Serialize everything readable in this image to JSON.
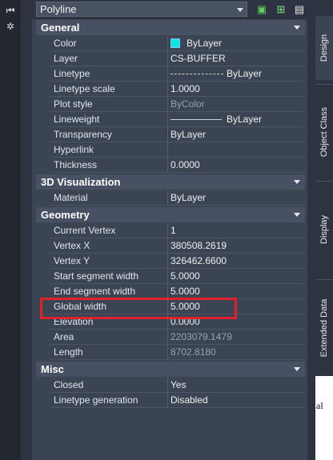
{
  "palette": {
    "object_type": "Polyline",
    "toolbar": {
      "quick_select_icon": "quick-select-icon",
      "select_objects_icon": "select-objects-icon",
      "toggle_pickadd_icon": "toggle-pickadd-icon"
    },
    "left_icons": [
      "pin-icon",
      "settings-icon"
    ]
  },
  "sections": [
    {
      "title": "General",
      "rows": [
        {
          "label": "Color",
          "value": "ByLayer",
          "swatch": "#00e6e6"
        },
        {
          "label": "Layer",
          "value": "CS-BUFFER"
        },
        {
          "label": "Linetype",
          "value": "ByLayer",
          "line": "dashed"
        },
        {
          "label": "Linetype scale",
          "value": "1.0000"
        },
        {
          "label": "Plot style",
          "value": "ByColor",
          "dim": true
        },
        {
          "label": "Lineweight",
          "value": "ByLayer",
          "line": "solid"
        },
        {
          "label": "Transparency",
          "value": "ByLayer"
        },
        {
          "label": "Hyperlink",
          "value": ""
        },
        {
          "label": "Thickness",
          "value": "0.0000"
        }
      ]
    },
    {
      "title": "3D Visualization",
      "rows": [
        {
          "label": "Material",
          "value": "ByLayer"
        }
      ]
    },
    {
      "title": "Geometry",
      "rows": [
        {
          "label": "Current Vertex",
          "value": "1"
        },
        {
          "label": "Vertex X",
          "value": "380508.2619"
        },
        {
          "label": "Vertex Y",
          "value": "326462.6600"
        },
        {
          "label": "Start segment width",
          "value": "5.0000"
        },
        {
          "label": "End segment width",
          "value": "5.0000"
        },
        {
          "label": "Global width",
          "value": "5.0000"
        },
        {
          "label": "Elevation",
          "value": "0.0000"
        },
        {
          "label": "Area",
          "value": "2203079.1479",
          "dim": true
        },
        {
          "label": "Length",
          "value": "8702.8180",
          "dim": true
        }
      ]
    },
    {
      "title": "Misc",
      "rows": [
        {
          "label": "Closed",
          "value": "Yes"
        },
        {
          "label": "Linetype generation",
          "value": "Disabled"
        }
      ]
    }
  ],
  "side_tabs": [
    "Design",
    "Object Class",
    "Display",
    "Extended Data"
  ],
  "background_doc_text": "al",
  "colors": {
    "highlight": "#e0202a",
    "swatch": "#00e6e6"
  }
}
